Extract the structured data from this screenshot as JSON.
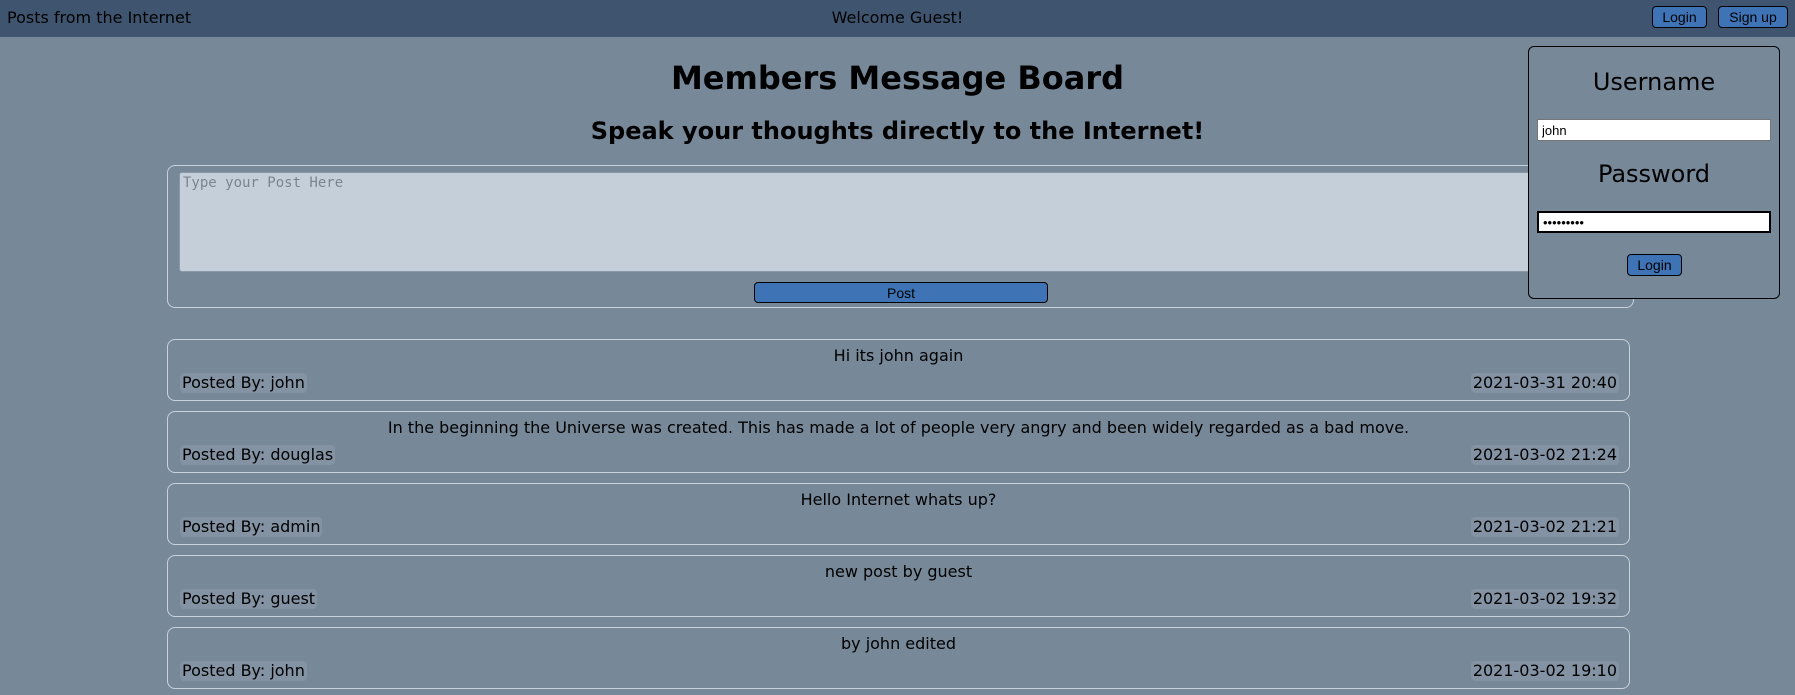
{
  "header": {
    "site_title": "Posts from the Internet",
    "welcome": "Welcome Guest!",
    "login_label": "Login",
    "signup_label": "Sign up"
  },
  "main": {
    "title": "Members Message Board",
    "subtitle": "Speak your thoughts directly to the Internet!",
    "post_placeholder": "Type your Post Here",
    "post_button": "Post"
  },
  "posts": [
    {
      "text": "Hi its john again",
      "author": "Posted By: john",
      "date": "2021-03-31 20:40"
    },
    {
      "text": "In the beginning the Universe was created. This has made a lot of people very angry and been widely regarded as a bad move.",
      "author": "Posted By: douglas",
      "date": "2021-03-02 21:24"
    },
    {
      "text": "Hello Internet whats up?",
      "author": "Posted By: admin",
      "date": "2021-03-02 21:21"
    },
    {
      "text": "new post by guest",
      "author": "Posted By: guest",
      "date": "2021-03-02 19:32"
    },
    {
      "text": "by john edited",
      "author": "Posted By: john",
      "date": "2021-03-02 19:10"
    }
  ],
  "login_panel": {
    "username_label": "Username",
    "username_value": "john",
    "password_label": "Password",
    "password_value": "•••••••••",
    "login_button": "Login"
  },
  "colors": {
    "background": "#778899",
    "topbar": "#3f556f",
    "button": "#3e73b5",
    "textarea": "#c5cfd9"
  }
}
